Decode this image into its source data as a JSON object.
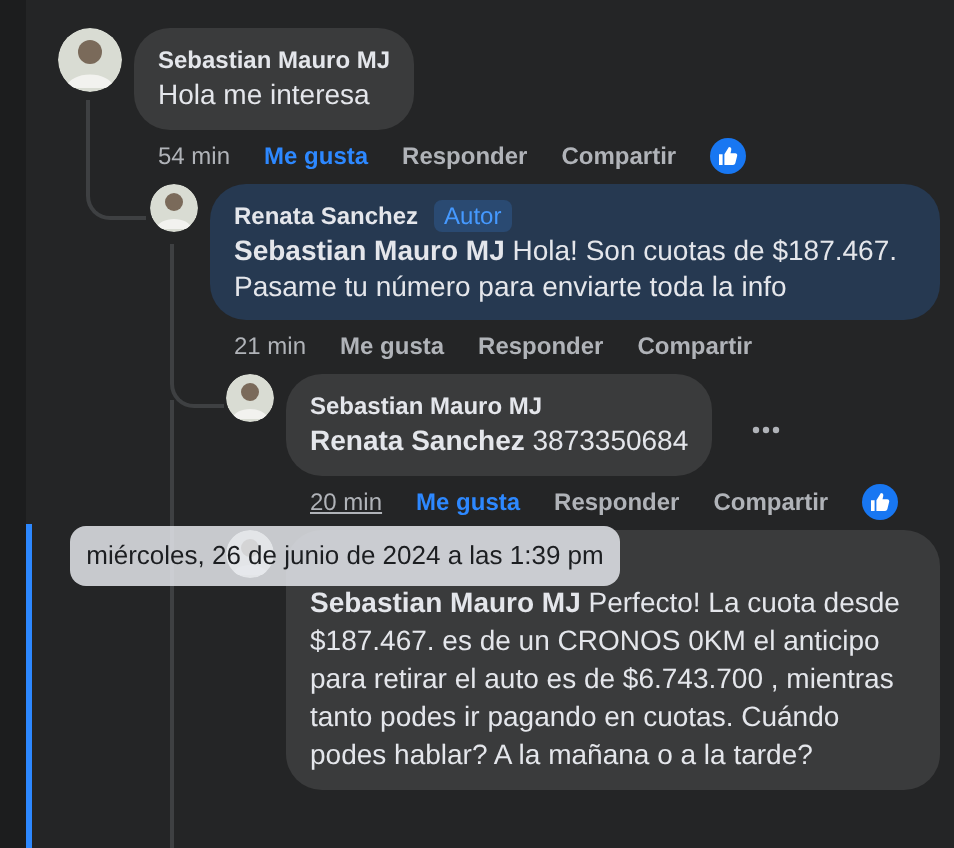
{
  "comments": [
    {
      "author": "Sebastian Mauro MJ",
      "text": "Hola me interesa",
      "time": "54 min",
      "time_hovered": false,
      "highlighted": false,
      "actions": [
        {
          "label": "Me gusta",
          "selected": true
        },
        {
          "label": "Responder",
          "selected": false
        },
        {
          "label": "Compartir",
          "selected": false
        }
      ],
      "reaction": true,
      "replies": [
        {
          "author": "Renata Sanchez",
          "badge": "Autor",
          "text": "**Sebastian Mauro MJ** Hola! Son cuotas de $187.467. Pasame tu número para enviarte toda la info",
          "time": "21 min",
          "time_hovered": false,
          "highlighted": true,
          "actions": [
            {
              "label": "Me gusta",
              "selected": false
            },
            {
              "label": "Responder",
              "selected": false
            },
            {
              "label": "Compartir",
              "selected": false
            }
          ],
          "replies": [
            {
              "author": "Sebastian Mauro MJ",
              "text": "**Renata Sanchez** 3873350684",
              "time": "20 min",
              "time_hovered": true,
              "highlighted": false,
              "menu_shown": true,
              "actions": [
                {
                  "label": "Me gusta",
                  "selected": true
                },
                {
                  "label": "Responder",
                  "selected": false
                },
                {
                  "label": "Compartir",
                  "selected": false
                }
              ],
              "reaction": true
            },
            {
              "text": "**Sebastian Mauro MJ** Perfecto! La cuota desde $187.467. es de un CRONOS 0KM el anticipo para retirar el auto es de $6.743.700 , mientras tanto podes ir pagando en cuotas. Cuándo podes hablar? A la mañana o a la tarde?",
              "highlighted": false,
              "focused": true
            }
          ]
        }
      ]
    }
  ],
  "tooltip": "miércoles, 26 de junio de 2024 a las 1:39 pm"
}
